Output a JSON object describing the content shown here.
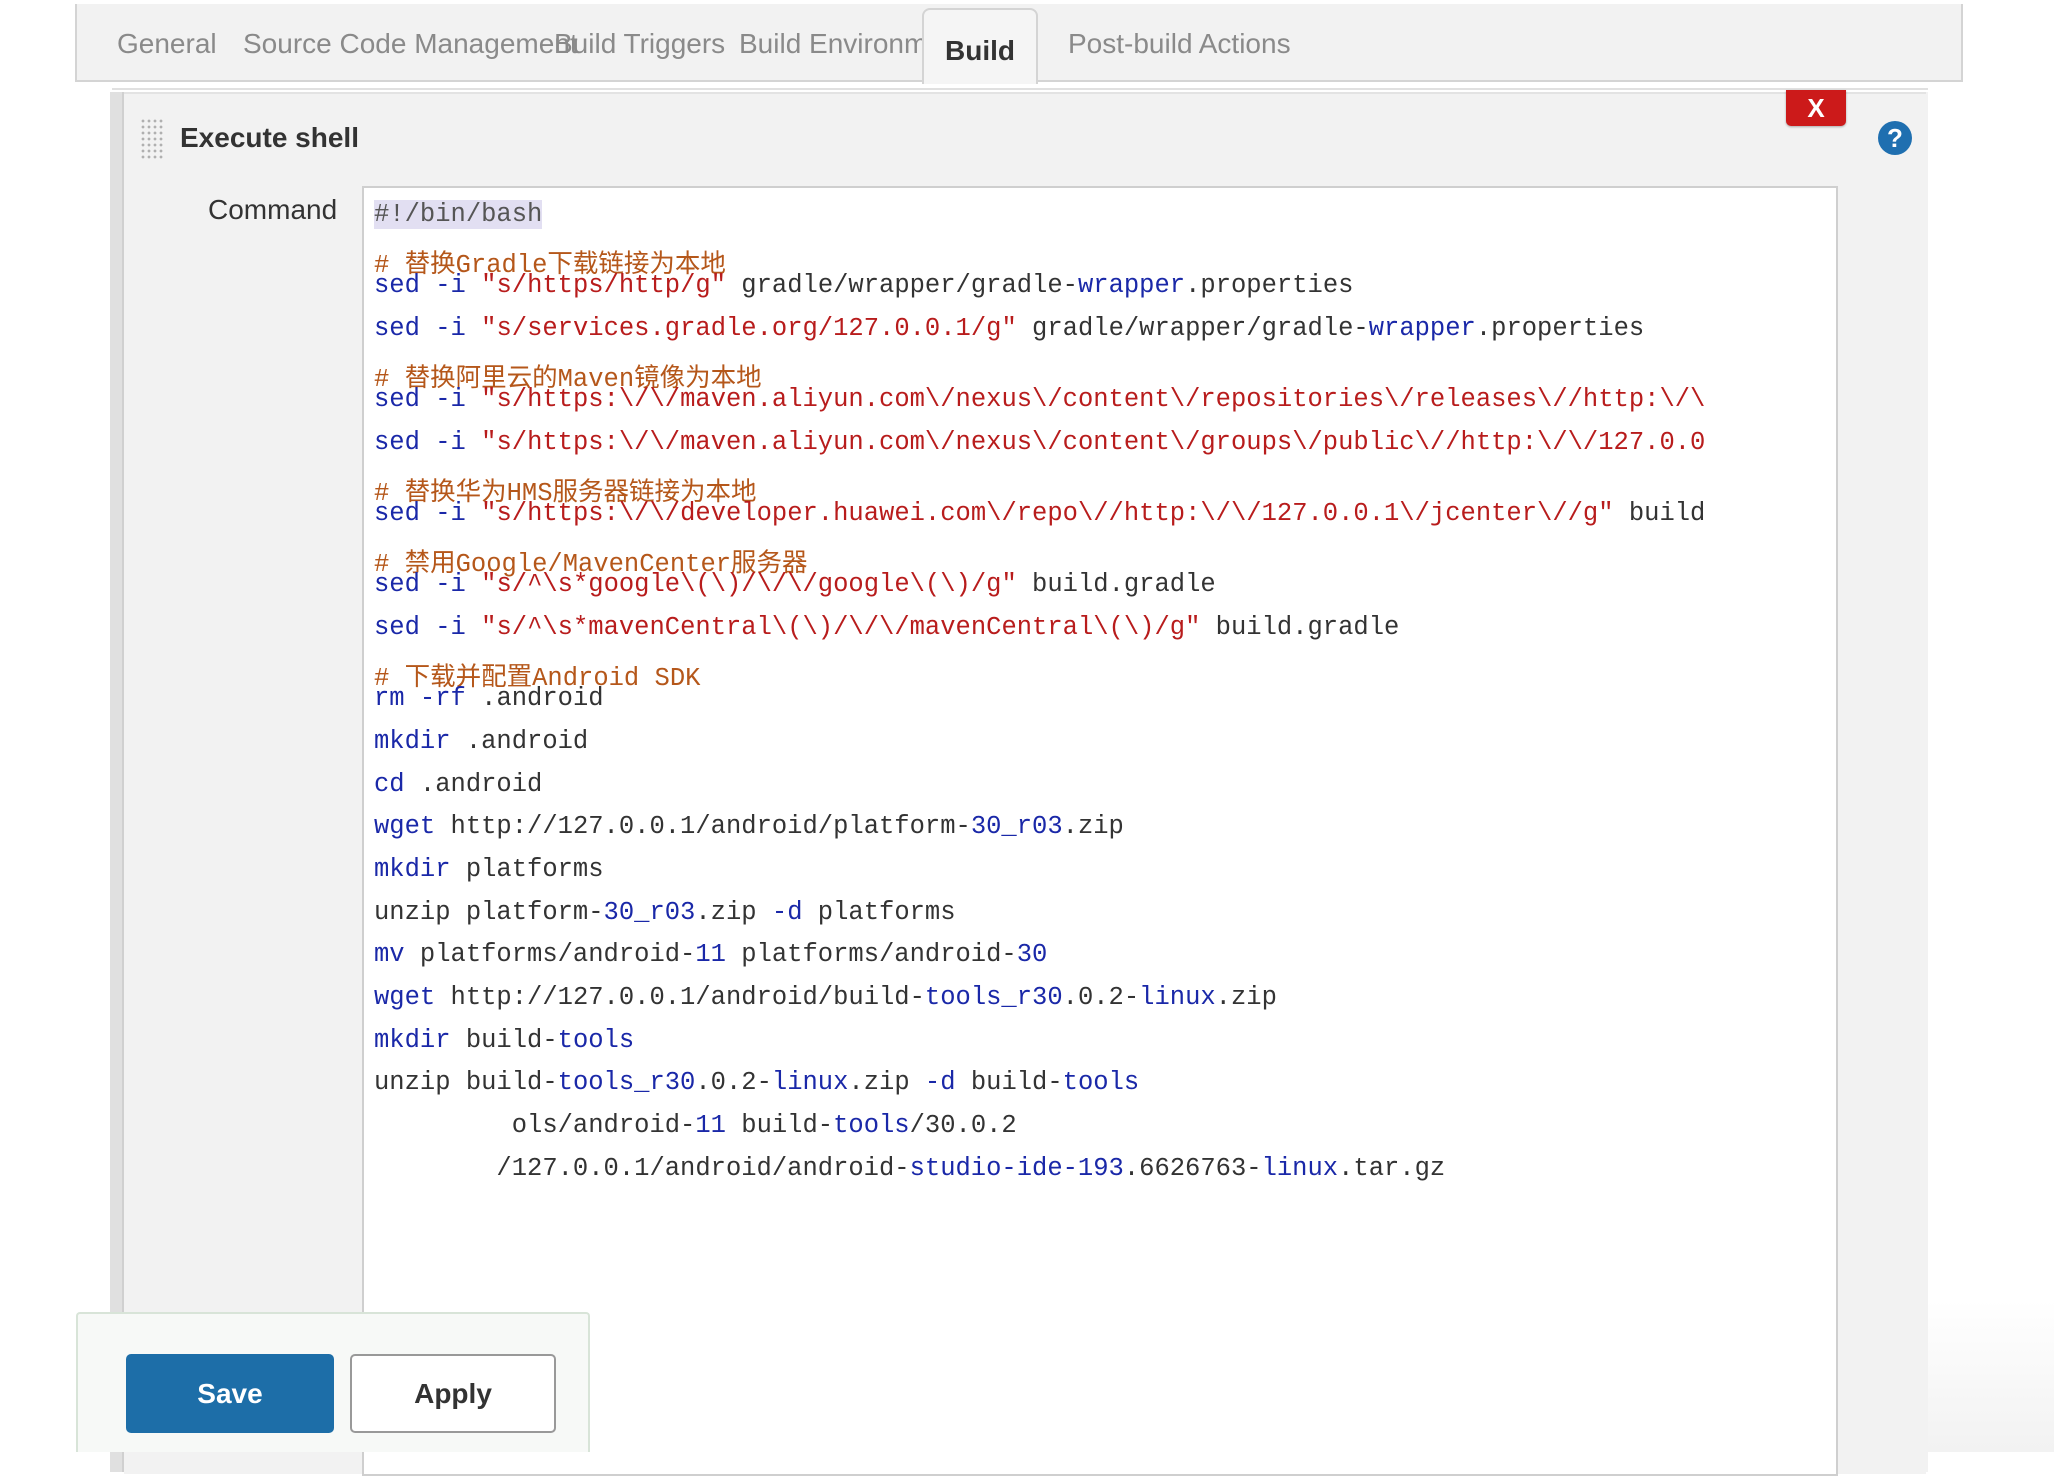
{
  "tabs": [
    {
      "label": "General"
    },
    {
      "label": "Source Code Management"
    },
    {
      "label": "Build Triggers"
    },
    {
      "label": "Build Environment"
    },
    {
      "label": "Build",
      "active": true
    },
    {
      "label": "Post-build Actions"
    }
  ],
  "step": {
    "title": "Execute shell",
    "delete_label": "X",
    "help_label": "?",
    "command_label": "Command"
  },
  "code_lines": [
    [
      [
        "shebang",
        "#!/bin/bash"
      ]
    ],
    [],
    [
      [
        "comment",
        "# 替换Gradle下载链接为本地"
      ]
    ],
    [
      [
        "kw",
        "sed"
      ],
      [
        "plain",
        " "
      ],
      [
        "kw",
        "-i"
      ],
      [
        "plain",
        " "
      ],
      [
        "str",
        "\"s/https/http/g\""
      ],
      [
        "plain",
        " gradle/wrapper/gradle-"
      ],
      [
        "kw",
        "wrapper"
      ],
      [
        "plain",
        ".properties"
      ]
    ],
    [],
    [
      [
        "kw",
        "sed"
      ],
      [
        "plain",
        " "
      ],
      [
        "kw",
        "-i"
      ],
      [
        "plain",
        " "
      ],
      [
        "str",
        "\"s/services.gradle.org/127.0.0.1/g\""
      ],
      [
        "plain",
        " gradle/wrapper/gradle-"
      ],
      [
        "kw",
        "wrapper"
      ],
      [
        "plain",
        ".properties"
      ]
    ],
    [],
    [
      [
        "comment",
        "# 替换阿里云的Maven镜像为本地"
      ]
    ],
    [
      [
        "kw",
        "sed"
      ],
      [
        "plain",
        " "
      ],
      [
        "kw",
        "-i"
      ],
      [
        "plain",
        " "
      ],
      [
        "str",
        "\"s/https:\\/\\/maven.aliyun.com\\/nexus\\/content\\/repositories\\/releases\\//http:\\/\\"
      ]
    ],
    [],
    [
      [
        "kw",
        "sed"
      ],
      [
        "plain",
        " "
      ],
      [
        "kw",
        "-i"
      ],
      [
        "plain",
        " "
      ],
      [
        "str",
        "\"s/https:\\/\\/maven.aliyun.com\\/nexus\\/content\\/groups\\/public\\//http:\\/\\/127.0.0"
      ]
    ],
    [],
    [
      [
        "comment",
        "# 替换华为HMS服务器链接为本地"
      ]
    ],
    [
      [
        "kw",
        "sed"
      ],
      [
        "plain",
        " "
      ],
      [
        "kw",
        "-i"
      ],
      [
        "plain",
        " "
      ],
      [
        "str",
        "\"s/https:\\/\\/developer.huawei.com\\/repo\\//http:\\/\\/127.0.0.1\\/jcenter\\//g\""
      ],
      [
        "plain",
        " build"
      ]
    ],
    [],
    [
      [
        "comment",
        "# 禁用Google/MavenCenter服务器"
      ]
    ],
    [
      [
        "kw",
        "sed"
      ],
      [
        "plain",
        " "
      ],
      [
        "kw",
        "-i"
      ],
      [
        "plain",
        " "
      ],
      [
        "str",
        "\"s/^\\s*google\\(\\)/\\/\\/google\\(\\)/g\""
      ],
      [
        "plain",
        " build.gradle"
      ]
    ],
    [],
    [
      [
        "kw",
        "sed"
      ],
      [
        "plain",
        " "
      ],
      [
        "kw",
        "-i"
      ],
      [
        "plain",
        " "
      ],
      [
        "str",
        "\"s/^\\s*mavenCentral\\(\\)/\\/\\/mavenCentral\\(\\)/g\""
      ],
      [
        "plain",
        " build.gradle"
      ]
    ],
    [],
    [
      [
        "comment",
        "# 下载并配置Android SDK"
      ]
    ],
    [
      [
        "kw",
        "rm"
      ],
      [
        "plain",
        " "
      ],
      [
        "kw",
        "-rf"
      ],
      [
        "plain",
        " .android"
      ]
    ],
    [],
    [
      [
        "kw",
        "mkdir"
      ],
      [
        "plain",
        " .android"
      ]
    ],
    [],
    [
      [
        "kw",
        "cd"
      ],
      [
        "plain",
        " .android"
      ]
    ],
    [],
    [
      [
        "kw",
        "wget"
      ],
      [
        "plain",
        " http://127.0.0.1/android/platform-"
      ],
      [
        "num",
        "30_r03"
      ],
      [
        "plain",
        ".zip"
      ]
    ],
    [],
    [
      [
        "kw",
        "mkdir"
      ],
      [
        "plain",
        " platforms"
      ]
    ],
    [],
    [
      [
        "plain",
        "unzip platform-"
      ],
      [
        "num",
        "30_r03"
      ],
      [
        "plain",
        ".zip "
      ],
      [
        "kw",
        "-d"
      ],
      [
        "plain",
        " platforms"
      ]
    ],
    [],
    [
      [
        "kw",
        "mv"
      ],
      [
        "plain",
        " platforms/android-"
      ],
      [
        "num",
        "11"
      ],
      [
        "plain",
        " platforms/android-"
      ],
      [
        "num",
        "30"
      ]
    ],
    [],
    [
      [
        "kw",
        "wget"
      ],
      [
        "plain",
        " http://127.0.0.1/android/build-"
      ],
      [
        "kw",
        "tools_r30"
      ],
      [
        "plain",
        ".0.2-"
      ],
      [
        "kw",
        "linux"
      ],
      [
        "plain",
        ".zip"
      ]
    ],
    [],
    [
      [
        "kw",
        "mkdir"
      ],
      [
        "plain",
        " build-"
      ],
      [
        "kw",
        "tools"
      ]
    ],
    [],
    [
      [
        "plain",
        "unzip build-"
      ],
      [
        "kw",
        "tools_r30"
      ],
      [
        "plain",
        ".0.2-"
      ],
      [
        "kw",
        "linux"
      ],
      [
        "plain",
        ".zip "
      ],
      [
        "kw",
        "-d"
      ],
      [
        "plain",
        " build-"
      ],
      [
        "kw",
        "tools"
      ]
    ],
    [],
    [
      [
        "plain",
        "         ols/android-"
      ],
      [
        "num",
        "11"
      ],
      [
        "plain",
        " build-"
      ],
      [
        "kw",
        "tools"
      ],
      [
        "plain",
        "/30.0.2"
      ]
    ],
    [],
    [
      [
        "plain",
        "        /127.0.0.1/android/android-"
      ],
      [
        "kw",
        "studio-ide-193"
      ],
      [
        "plain",
        ".6626763-"
      ],
      [
        "kw",
        "linux"
      ],
      [
        "plain",
        ".tar.gz"
      ]
    ]
  ],
  "actions": {
    "save_label": "Save",
    "apply_label": "Apply"
  }
}
